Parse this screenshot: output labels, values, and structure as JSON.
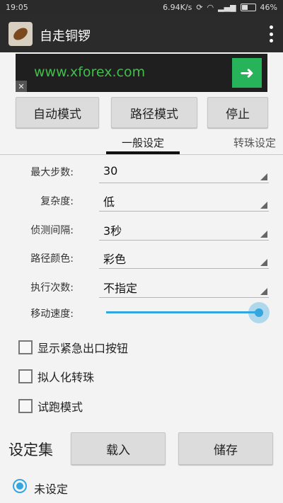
{
  "status_bar": {
    "time": "19:05",
    "net_speed": "6.94K/s",
    "battery": "46%",
    "battery_level": 0.46
  },
  "app": {
    "title": "自走铜锣"
  },
  "ad": {
    "text": "www.xforex.com",
    "arrow": "➜",
    "close": "✕"
  },
  "buttons": {
    "auto": "自动模式",
    "path": "路径模式",
    "stop": "停止"
  },
  "tabs": {
    "general": "一般设定",
    "other": "转珠设定"
  },
  "settings": {
    "max_steps": {
      "label": "最大步数:",
      "value": "30"
    },
    "complexity": {
      "label": "复杂度:",
      "value": "低"
    },
    "interval": {
      "label": "侦测间隔:",
      "value": "3秒"
    },
    "path_color": {
      "label": "路径颜色:",
      "value": "彩色"
    },
    "exec_count": {
      "label": "执行次数:",
      "value": "不指定"
    },
    "speed": {
      "label": "移动速度:",
      "level": 1.0
    }
  },
  "checkboxes": {
    "emergency": {
      "label": "显示紧急出口按钮",
      "checked": false
    },
    "humanize": {
      "label": "拟人化转珠",
      "checked": false
    },
    "trial": {
      "label": "试跑模式",
      "checked": false
    }
  },
  "preset": {
    "title": "设定集",
    "load": "载入",
    "save": "储存"
  },
  "radio": {
    "label": "未设定",
    "selected": true
  },
  "colors": {
    "accent": "#33a6e0",
    "ad_green": "#27b35a",
    "bar_dark": "#2b2b2b"
  }
}
